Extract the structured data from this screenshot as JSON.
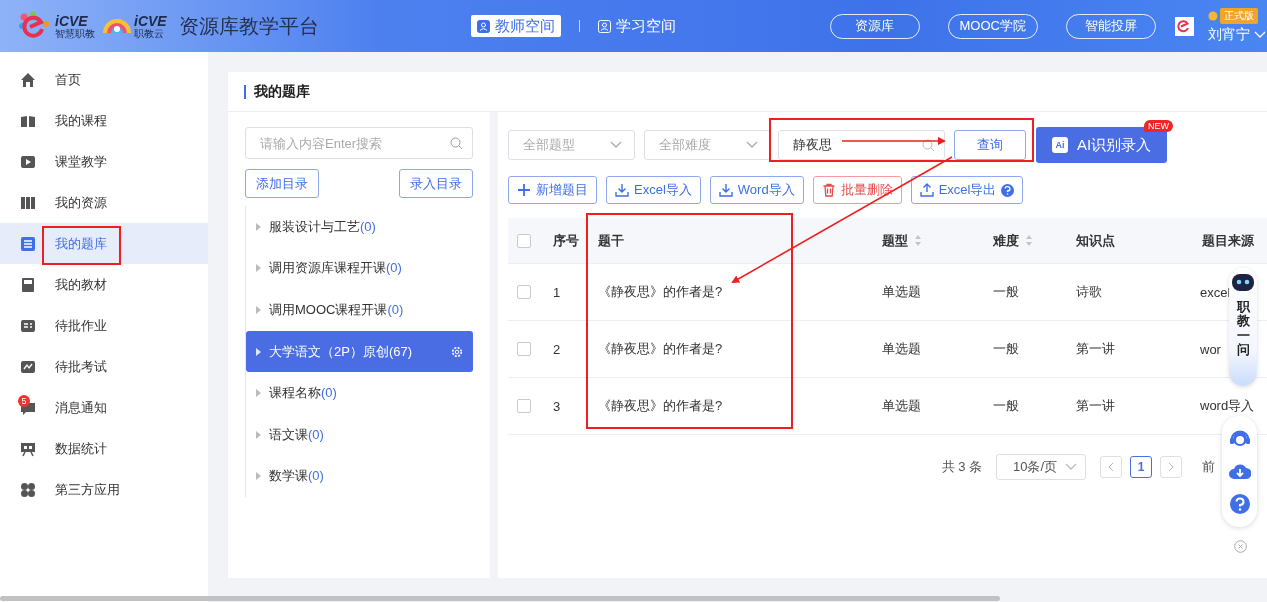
{
  "header": {
    "logos": [
      {
        "mark": "iCVE",
        "caption": "智慧职教"
      },
      {
        "mark": "iCVE",
        "caption": "职教云"
      }
    ],
    "title": "资源库教学平台",
    "spaces": [
      {
        "label": "教师空间",
        "selected": true
      },
      {
        "label": "学习空间",
        "selected": false
      }
    ],
    "links": [
      "资源库",
      "MOOC学院",
      "智能投屏"
    ],
    "user": {
      "badge": "正式版",
      "name": "刘宵宁"
    }
  },
  "sidebar": {
    "items": [
      {
        "label": "首页",
        "selected": false
      },
      {
        "label": "我的课程",
        "selected": false
      },
      {
        "label": "课堂教学",
        "selected": false
      },
      {
        "label": "我的资源",
        "selected": false
      },
      {
        "label": "我的题库",
        "selected": true
      },
      {
        "label": "我的教材",
        "selected": false
      },
      {
        "label": "待批作业",
        "selected": false
      },
      {
        "label": "待批考试",
        "selected": false
      },
      {
        "label": "消息通知",
        "selected": false,
        "badge": "5"
      },
      {
        "label": "数据统计",
        "selected": false
      },
      {
        "label": "第三方应用",
        "selected": false
      }
    ]
  },
  "page_title": "我的题库",
  "catalog": {
    "search_placeholder": "请输入内容Enter搜索",
    "buttons": [
      "添加目录",
      "录入目录"
    ],
    "items": [
      {
        "name": "服装设计与工艺",
        "count": "(0)",
        "selected": false
      },
      {
        "name": "调用资源库课程开课",
        "count": "(0)",
        "selected": false
      },
      {
        "name": "调用MOOC课程开课",
        "count": "(0)",
        "selected": false
      },
      {
        "name": "大学语文（2P）原创",
        "count": "(67)",
        "selected": true
      },
      {
        "name": "课程名称",
        "count": "(0)",
        "selected": false
      },
      {
        "name": "语文课",
        "count": "(0)",
        "selected": false
      },
      {
        "name": "数学课",
        "count": "(0)",
        "selected": false
      }
    ]
  },
  "filters": {
    "type_placeholder": "全部题型",
    "difficulty_placeholder": "全部难度",
    "search_value": "静夜思",
    "query_button": "查询",
    "ai_button": {
      "icon": "Ai",
      "label": "AI识别录入",
      "badge": "NEW"
    }
  },
  "actions": [
    {
      "label": "新增题目",
      "kind": "primary",
      "help": false
    },
    {
      "label": "Excel导入",
      "kind": "primary",
      "help": false
    },
    {
      "label": "Word导入",
      "kind": "primary",
      "help": false
    },
    {
      "label": "批量删除",
      "kind": "danger",
      "help": false
    },
    {
      "label": "Excel导出",
      "kind": "primary",
      "help": true
    }
  ],
  "table": {
    "select_all": {
      "checked": false
    },
    "columns": [
      {
        "label": "序号",
        "sortable": false
      },
      {
        "label": "题干",
        "sortable": false
      },
      {
        "label": "题型",
        "sortable": true
      },
      {
        "label": "难度",
        "sortable": true
      },
      {
        "label": "知识点",
        "sortable": false
      },
      {
        "label": "题目来源",
        "sortable": false
      }
    ],
    "rows": [
      {
        "checked": false,
        "cells": [
          "1",
          "《静夜思》的作者是?",
          "单选题",
          "一般",
          "诗歌",
          "excel"
        ]
      },
      {
        "checked": false,
        "cells": [
          "2",
          "《静夜思》的作者是?",
          "单选题",
          "一般",
          "第一讲",
          "wor"
        ]
      },
      {
        "checked": false,
        "cells": [
          "3",
          "《静夜思》的作者是?",
          "单选题",
          "一般",
          "第一讲",
          "word导入"
        ]
      }
    ]
  },
  "pagination": {
    "total": "共 3 条",
    "page_size": "10条/页",
    "pages": [
      {
        "label": "1",
        "selected": true
      }
    ],
    "goto": "前"
  },
  "assistant": {
    "label": "职教一问"
  }
}
